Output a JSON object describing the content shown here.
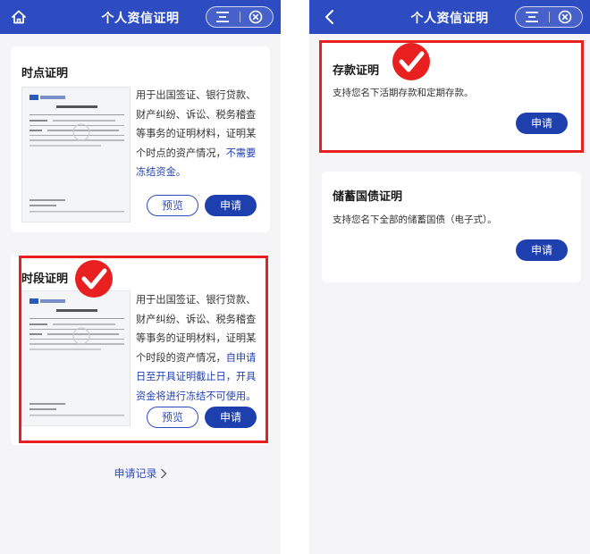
{
  "left_screen": {
    "header": {
      "title": "个人资信证明",
      "home_icon": "home-icon",
      "menu_icon": "menu-icon",
      "close_icon": "close-circle-icon"
    },
    "point_card": {
      "title": "时点证明",
      "description_plain": "用于出国签证、银行贷款、财产纠纷、诉讼、税务稽查等事务的证明材料，证明某个时点的资产情况，",
      "description_highlight": "不需要冻结资金。",
      "preview_button": "预览",
      "apply_button": "申请"
    },
    "period_card": {
      "title": "时段证明",
      "description_plain": "用于出国签证、银行贷款、财产纠纷、诉讼、税务稽查等事务的证明材料，证明某个时段的资产情况，",
      "description_highlight": "自申请日至开具证明截止日，开具资金将进行冻结不可使用。",
      "preview_button": "预览",
      "apply_button": "申请"
    },
    "records_link": "申请记录"
  },
  "right_screen": {
    "header": {
      "title": "个人资信证明",
      "back_icon": "back-chevron-icon",
      "menu_icon": "menu-icon",
      "close_icon": "close-circle-icon"
    },
    "deposit_card": {
      "title": "存款证明",
      "description": "支持您名下活期存款和定期存款。",
      "apply_button": "申请"
    },
    "bond_card": {
      "title": "储蓄国债证明",
      "description": "支持您名下全部的储蓄国债（电子式）。",
      "apply_button": "申请"
    }
  },
  "colors": {
    "header_blue": "#2d4cc2",
    "button_blue": "#1e3fae",
    "highlight_text": "#2040b0",
    "annotation_red": "#e82020"
  }
}
